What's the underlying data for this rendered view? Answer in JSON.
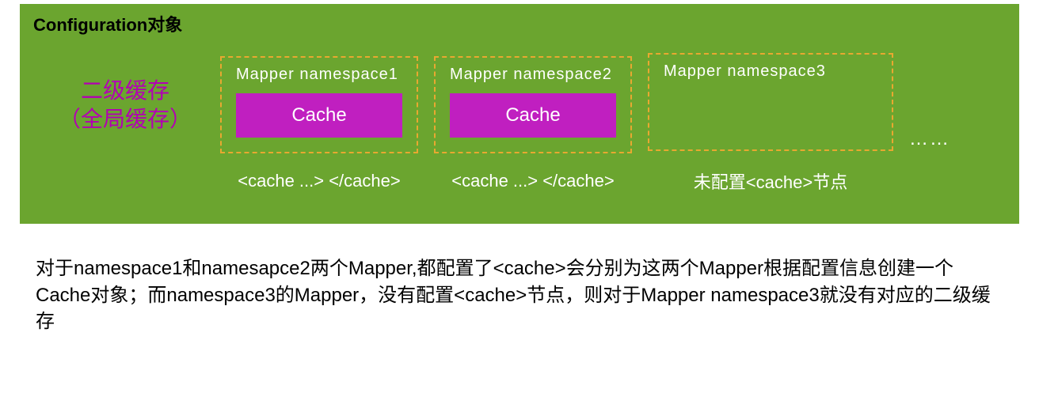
{
  "config": {
    "title": "Configuration对象",
    "cache_label_line1": "二级缓存",
    "cache_label_line2": "（全局缓存）",
    "namespaces": [
      {
        "title": "Mapper  namespace1",
        "cache_text": "Cache",
        "caption": "<cache ...> </cache>",
        "has_cache": true
      },
      {
        "title": "Mapper  namespace2",
        "cache_text": "Cache",
        "caption": "<cache ...> </cache>",
        "has_cache": true
      },
      {
        "title": "Mapper  namespace3",
        "cache_text": "",
        "caption": "未配置<cache>节点",
        "has_cache": false
      }
    ],
    "ellipsis": "……"
  },
  "description": "对于namespace1和namesapce2两个Mapper,都配置了<cache>会分别为这两个Mapper根据配置信息创建一个Cache对象；而namespace3的Mapper，没有配置<cache>节点，则对于Mapper namespace3就没有对应的二级缓存",
  "colors": {
    "green_bg": "#6BA52F",
    "purple_text": "#B300B3",
    "purple_block": "#C01FC0",
    "orange_border": "#E8A830"
  }
}
